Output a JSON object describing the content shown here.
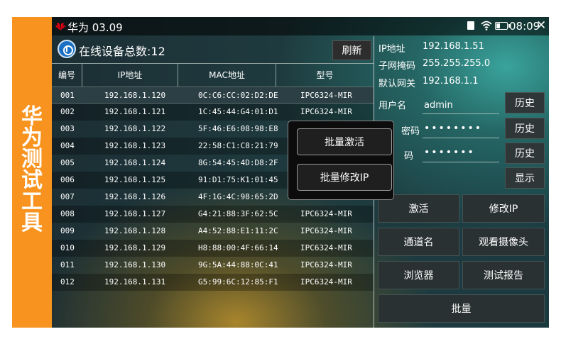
{
  "side_banner": {
    "title_chars": [
      "华",
      "为",
      "测",
      "试",
      "工",
      "具"
    ]
  },
  "status_bar": {
    "title": "华为 03.09",
    "time": "08:09",
    "icons": [
      "huawei-logo-icon",
      "sd-card-icon",
      "wifi-icon",
      "battery-icon",
      "close-icon"
    ]
  },
  "header": {
    "online_label": "在线设备总数:12",
    "refresh_label": "刷新"
  },
  "table": {
    "columns": [
      "编号",
      "IP地址",
      "MAC地址",
      "型号"
    ],
    "rows": [
      [
        "001",
        "192.168.1.120",
        "0C:C6:CC:02:D2:DE",
        "IPC6324-MIR"
      ],
      [
        "002",
        "192.168.1.121",
        "1C:45:44:G4:01:D1",
        "IPC6324-MIR"
      ],
      [
        "003",
        "192.168.1.122",
        "5F:46:E6:08:98:E8",
        ""
      ],
      [
        "004",
        "192.168.1.123",
        "22:58:C1:C8:21:79",
        ""
      ],
      [
        "005",
        "192.168.1.124",
        "8G:54:45:4D:D8:2F",
        ""
      ],
      [
        "006",
        "192.168.1.125",
        "91:D1:75:K1:01:45",
        ""
      ],
      [
        "007",
        "192.168.1.126",
        "4F:1G:4C:98:65:2D",
        ""
      ],
      [
        "008",
        "192.168.1.127",
        "G4:21:88:3F:62:5C",
        "IPC6324-MIR"
      ],
      [
        "009",
        "192.168.1.128",
        "A4:52:88:E1:11:2C",
        "IPC6324-MIR"
      ],
      [
        "010",
        "192.168.1.129",
        "H8:88:00:4F:66:14",
        "IPC6324-MIR"
      ],
      [
        "011",
        "192.168.1.130",
        "9G:5A:44:88:0C:41",
        "IPC6324-MIR"
      ],
      [
        "012",
        "192.168.1.131",
        "G5:99:6C:12:85:F1",
        "IPC6324-MIR"
      ]
    ]
  },
  "device_info": {
    "ip_label": "IP地址",
    "ip_value": "192.168.1.51",
    "mask_label": "子网掩码",
    "mask_value": "255.255.255.0",
    "gateway_label": "默认网关",
    "gateway_value": "192.168.1.1",
    "user_label": "用户名",
    "user_value": "admin",
    "password_label": "密码",
    "password_value": "••••••••",
    "password2_label": "码",
    "password2_value": "•••••••",
    "history_label": "历史",
    "show_label": "显示"
  },
  "actions": {
    "activate": "激活",
    "modify_ip": "修改IP",
    "channel_name": "通道名",
    "view_camera": "观看摄像头",
    "browser": "浏览器",
    "test_report": "测试报告",
    "batch": "批量"
  },
  "popup": {
    "batch_activate": "批量激活",
    "batch_modify_ip": "批量修改IP"
  },
  "colors": {
    "banner": "#f7931e",
    "accent_blue": "#1b6fc2",
    "selected_row": "#2b3f44"
  }
}
